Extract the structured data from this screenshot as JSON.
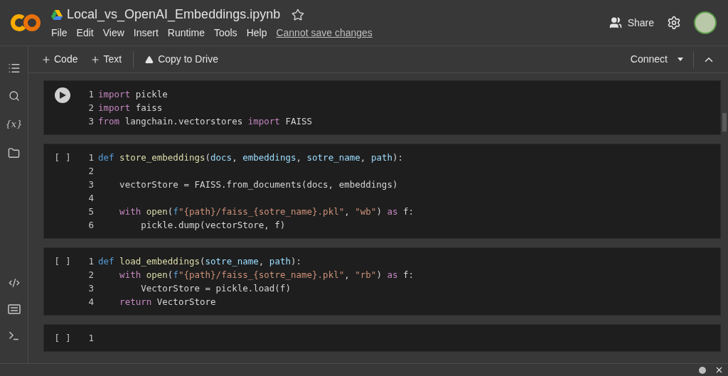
{
  "header": {
    "title": "Local_vs_OpenAI_Embeddings.ipynb",
    "starred": false,
    "menu": [
      "File",
      "Edit",
      "View",
      "Insert",
      "Runtime",
      "Tools",
      "Help"
    ],
    "save_notice": "Cannot save changes",
    "share": "Share"
  },
  "sidebar": {
    "variables": "{x}"
  },
  "toolbar": {
    "add_code": "Code",
    "add_text": "Text",
    "copy": "Copy to Drive",
    "connect": "Connect"
  },
  "cells": [
    {
      "kind": "run",
      "lines": [
        {
          "number": "1",
          "tokens": [
            {
              "kind": "kw",
              "text": "import"
            },
            {
              "kind": "plain",
              "text": " pickle"
            }
          ]
        },
        {
          "number": "2",
          "tokens": [
            {
              "kind": "kw",
              "text": "import"
            },
            {
              "kind": "plain",
              "text": " faiss"
            }
          ]
        },
        {
          "number": "3",
          "tokens": [
            {
              "kind": "kw",
              "text": "from"
            },
            {
              "kind": "plain",
              "text": " langchain.vectorstores "
            },
            {
              "kind": "kw",
              "text": "import"
            },
            {
              "kind": "plain",
              "text": " FAISS"
            }
          ]
        }
      ]
    },
    {
      "kind": "idle",
      "status": "[ ]",
      "lines": [
        {
          "number": "1",
          "tokens": [
            {
              "kind": "def",
              "text": "def"
            },
            {
              "kind": "func",
              "text": " store_embeddings"
            },
            {
              "kind": "plain",
              "text": "("
            },
            {
              "kind": "param",
              "text": "docs"
            },
            {
              "kind": "plain",
              "text": ", "
            },
            {
              "kind": "param",
              "text": "embeddings"
            },
            {
              "kind": "plain",
              "text": ", "
            },
            {
              "kind": "param",
              "text": "sotre_name"
            },
            {
              "kind": "plain",
              "text": ", "
            },
            {
              "kind": "param",
              "text": "path"
            },
            {
              "kind": "plain",
              "text": "):"
            }
          ]
        },
        {
          "number": "2"
        },
        {
          "number": "3",
          "tokens": [
            {
              "kind": "plain",
              "text": "    vectorStore = FAISS.from_documents(docs, embeddings)"
            }
          ]
        },
        {
          "number": "4"
        },
        {
          "number": "5",
          "tokens": [
            {
              "kind": "kw",
              "text": "    with"
            },
            {
              "kind": "func",
              "text": " open"
            },
            {
              "kind": "plain",
              "text": "("
            },
            {
              "kind": "def",
              "text": "f"
            },
            {
              "kind": "string",
              "text": "\"{path}/faiss_{sotre_name}.pkl\""
            },
            {
              "kind": "plain",
              "text": ", "
            },
            {
              "kind": "string",
              "text": "\"wb\""
            },
            {
              "kind": "plain",
              "text": ") "
            },
            {
              "kind": "kw",
              "text": "as"
            },
            {
              "kind": "plain",
              "text": " f:"
            }
          ]
        },
        {
          "number": "6",
          "tokens": [
            {
              "kind": "plain",
              "text": "        pickle.dump(vectorStore, f)"
            }
          ]
        }
      ]
    },
    {
      "kind": "idle",
      "status": "[ ]",
      "lines": [
        {
          "number": "1",
          "tokens": [
            {
              "kind": "def",
              "text": "def"
            },
            {
              "kind": "func",
              "text": " load_embeddings"
            },
            {
              "kind": "plain",
              "text": "("
            },
            {
              "kind": "param",
              "text": "sotre_name"
            },
            {
              "kind": "plain",
              "text": ", "
            },
            {
              "kind": "param",
              "text": "path"
            },
            {
              "kind": "plain",
              "text": "):"
            }
          ]
        },
        {
          "number": "2",
          "tokens": [
            {
              "kind": "kw",
              "text": "    with"
            },
            {
              "kind": "func",
              "text": " open"
            },
            {
              "kind": "plain",
              "text": "("
            },
            {
              "kind": "def",
              "text": "f"
            },
            {
              "kind": "string",
              "text": "\"{path}/faiss_{sotre_name}.pkl\""
            },
            {
              "kind": "plain",
              "text": ", "
            },
            {
              "kind": "string",
              "text": "\"rb\""
            },
            {
              "kind": "plain",
              "text": ") "
            },
            {
              "kind": "kw",
              "text": "as"
            },
            {
              "kind": "plain",
              "text": " f:"
            }
          ]
        },
        {
          "number": "3",
          "tokens": [
            {
              "kind": "plain",
              "text": "        VectorStore = pickle.load(f)"
            }
          ]
        },
        {
          "number": "4",
          "tokens": [
            {
              "kind": "kw",
              "text": "    return"
            },
            {
              "kind": "plain",
              "text": " VectorStore"
            }
          ]
        }
      ]
    },
    {
      "kind": "idle",
      "status": "[ ]",
      "lines": [
        {
          "number": "1"
        }
      ]
    }
  ]
}
